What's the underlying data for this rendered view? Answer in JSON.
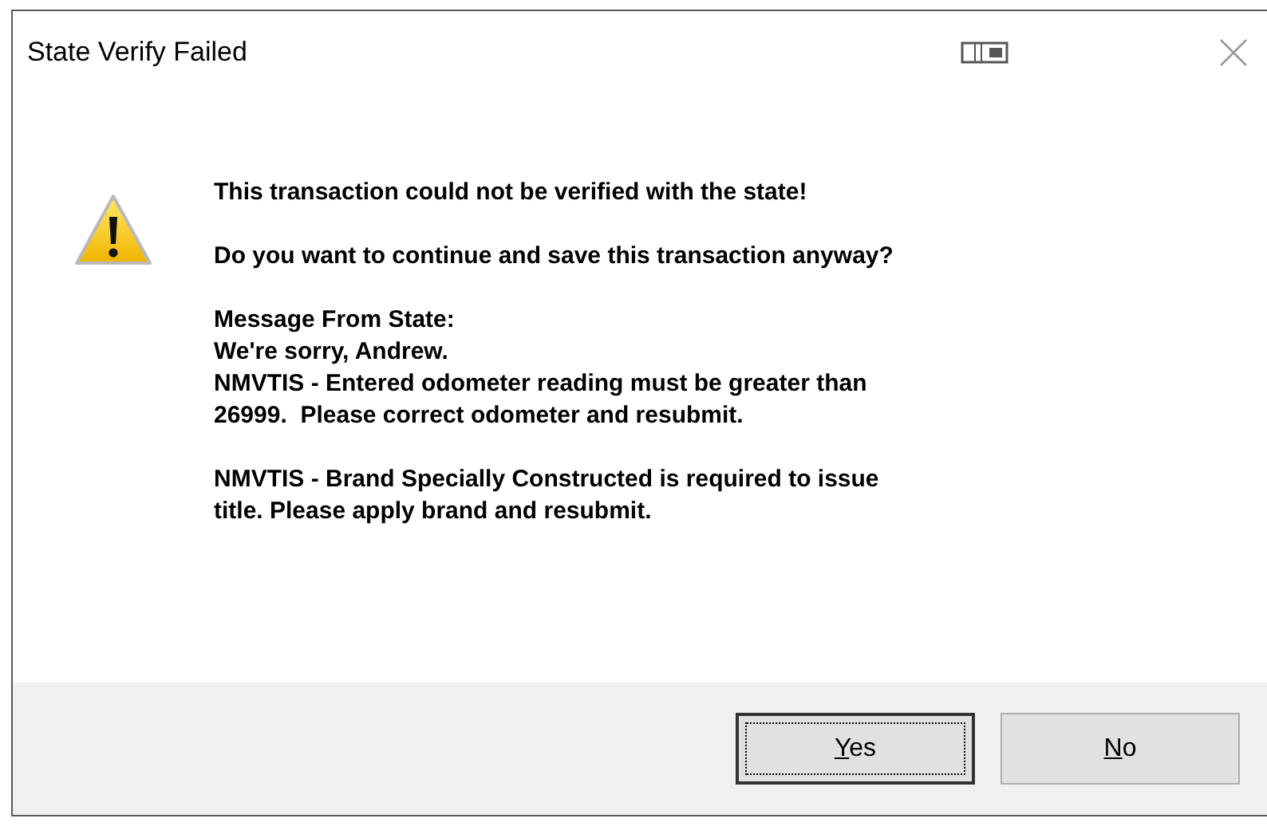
{
  "window": {
    "title": "State Verify Failed"
  },
  "message": {
    "paragraphs": [
      [
        "This transaction could not be verified with the state!"
      ],
      [
        "Do you want to continue and save this transaction anyway?"
      ],
      [
        "Message From State:",
        "We're sorry, Andrew.",
        "NMVTIS - Entered odometer reading must be greater than",
        "26999.  Please correct odometer and resubmit."
      ],
      [
        "NMVTIS - Brand Specially Constructed is required to issue",
        "title. Please apply brand and resubmit."
      ]
    ]
  },
  "buttons": [
    {
      "access_key": "Y",
      "rest": "es",
      "default": true
    },
    {
      "access_key": "N",
      "rest": "o",
      "default": false
    }
  ]
}
